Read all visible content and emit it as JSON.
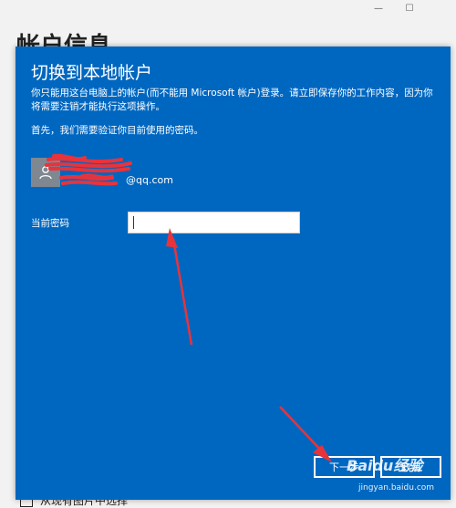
{
  "window": {
    "minimize_glyph": "—",
    "maximize_glyph": "☐",
    "close_glyph": ""
  },
  "background": {
    "title": "帐户信息",
    "checkbox_label": "从现有图片中选择"
  },
  "dialog": {
    "title": "切换到本地帐户",
    "description": "你只能用这台电脑上的帐户(而不能用 Microsoft 帐户)登录。请立即保存你的工作内容，因为你将需要注销才能执行这项操作。",
    "first_step": "首先，我们需要验证你目前使用的密码。",
    "account": {
      "name": "",
      "email": "@qq.com"
    },
    "password_label": "当前密码",
    "password_value": "",
    "next_button": "下一步",
    "cancel_button": "取消"
  },
  "watermark": {
    "logo": "Baidu经验",
    "site": "jingyan.baidu.com"
  },
  "colors": {
    "dialog_bg": "#0067c0",
    "annotation_red": "#e8333b"
  },
  "icons": {
    "avatar": "person-icon"
  }
}
